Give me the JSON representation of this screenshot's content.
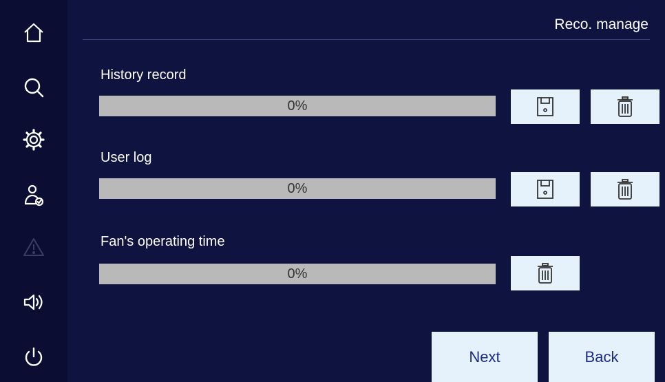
{
  "header": {
    "title": "Reco. manage"
  },
  "sidebar": {
    "items": [
      {
        "icon": "home-icon",
        "enabled": true
      },
      {
        "icon": "search-icon",
        "enabled": true
      },
      {
        "icon": "gear-icon",
        "enabled": true
      },
      {
        "icon": "user-check-icon",
        "enabled": true
      },
      {
        "icon": "warning-icon",
        "enabled": false
      },
      {
        "icon": "speaker-icon",
        "enabled": true
      },
      {
        "icon": "power-icon",
        "enabled": true
      }
    ]
  },
  "records": [
    {
      "label": "History record",
      "progress_text": "0%",
      "progress_value": 0,
      "buttons": [
        "save-icon",
        "trash-icon"
      ]
    },
    {
      "label": "User log",
      "progress_text": "0%",
      "progress_value": 0,
      "buttons": [
        "save-icon",
        "trash-icon"
      ]
    },
    {
      "label": "Fan's operating time",
      "progress_text": "0%",
      "progress_value": 0,
      "buttons": [
        "trash-icon"
      ]
    }
  ],
  "footer": {
    "next_label": "Next",
    "back_label": "Back"
  },
  "colors": {
    "background": "#0f1340",
    "sidebar": "#0b0e32",
    "button_bg": "#e6f2fb",
    "progress_track": "#b9b9b9",
    "button_text": "#1c2b8a"
  }
}
